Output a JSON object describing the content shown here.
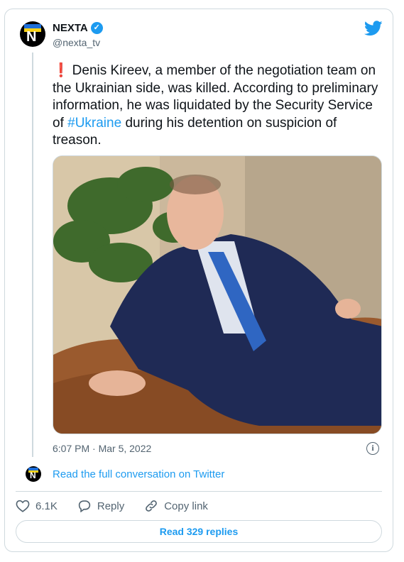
{
  "author": {
    "name": "NEXTA",
    "handle": "@nexta_tv",
    "avatar_letter": "N",
    "verified": true
  },
  "tweet": {
    "alert_glyph": "❗",
    "text_before_hashtag": "Denis Kireev, a member of the negotiation team on the Ukrainian side, was killed. According to preliminary information, he was liquidated by the Security Service of ",
    "hashtag": "#Ukraine",
    "text_after_hashtag": " during his detention on suspicion of treason."
  },
  "meta": {
    "timestamp": "6:07 PM · Mar 5, 2022",
    "info_glyph": "i"
  },
  "conversation": {
    "read_link": "Read the full conversation on Twitter",
    "avatar_letter": "N"
  },
  "actions": {
    "likes_count": "6.1K",
    "reply_label": "Reply",
    "copy_link_label": "Copy link"
  },
  "replies_button": "Read 329 replies",
  "colors": {
    "twitter_blue": "#1d9bf0",
    "secondary_text": "#536471",
    "border": "#cfd9de",
    "alert_red": "#e0245e"
  },
  "icons": {
    "brand": "twitter-bird-icon",
    "like": "heart-icon",
    "reply": "speech-bubble-icon",
    "copy": "link-icon",
    "info": "info-icon",
    "verified": "verified-badge-icon"
  }
}
